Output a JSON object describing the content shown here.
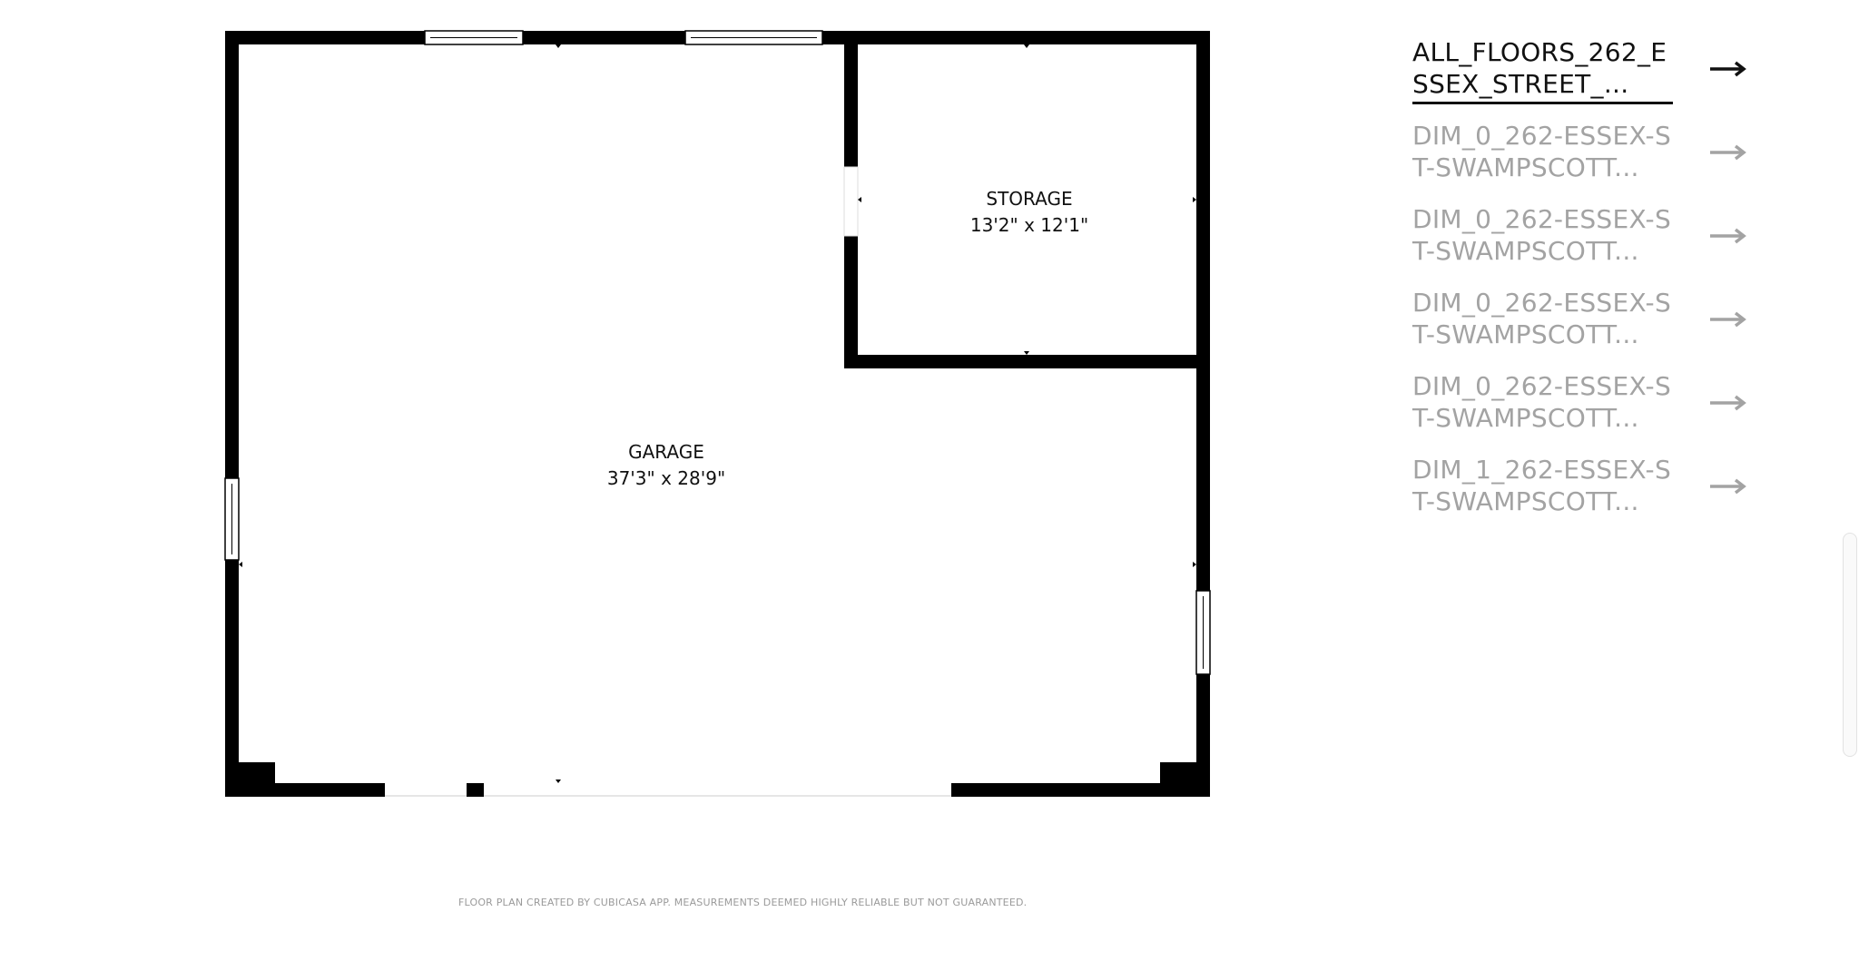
{
  "floor_plan": {
    "rooms": [
      {
        "name": "GARAGE",
        "dimensions": "37'3\" x 28'9\""
      },
      {
        "name": "STORAGE",
        "dimensions": "13'2\" x 12'1\""
      }
    ],
    "disclaimer": "FLOOR PLAN CREATED BY CUBICASA APP. MEASUREMENTS DEEMED HIGHLY RELIABLE BUT NOT GUARANTEED."
  },
  "file_list": {
    "items": [
      {
        "label": "ALL_FLOORS_262_ESSEX_STREET_...",
        "active": true,
        "icon": "arrow-right-icon"
      },
      {
        "label": "DIM_0_262-ESSEX-ST-SWAMPSCOTT...",
        "active": false,
        "icon": "arrow-right-icon"
      },
      {
        "label": "DIM_0_262-ESSEX-ST-SWAMPSCOTT...",
        "active": false,
        "icon": "arrow-right-icon"
      },
      {
        "label": "DIM_0_262-ESSEX-ST-SWAMPSCOTT...",
        "active": false,
        "icon": "arrow-right-icon"
      },
      {
        "label": "DIM_0_262-ESSEX-ST-SWAMPSCOTT...",
        "active": false,
        "icon": "arrow-right-icon"
      },
      {
        "label": "DIM_1_262-ESSEX-ST-SWAMPSCOTT...",
        "active": false,
        "icon": "arrow-right-icon"
      }
    ]
  },
  "colors": {
    "wall": "#000000",
    "active_text": "#111111",
    "inactive_text": "#a3a3a3",
    "disclaimer_text": "#9a9a9a"
  }
}
